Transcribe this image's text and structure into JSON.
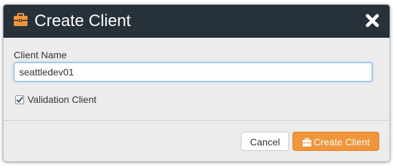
{
  "dialog": {
    "title": "Create Client",
    "header_icon": "briefcase-icon",
    "close_icon": "close-icon",
    "header_bg": "#27313a",
    "body_bg": "#ececec"
  },
  "form": {
    "client_name_label": "Client Name",
    "client_name_value": "seattledev01",
    "validation_checked": true,
    "validation_label": "Validation Client"
  },
  "buttons": {
    "cancel_label": "Cancel",
    "create_label": "Create Client",
    "create_icon": "briefcase-icon",
    "accent": "#f0953a"
  }
}
